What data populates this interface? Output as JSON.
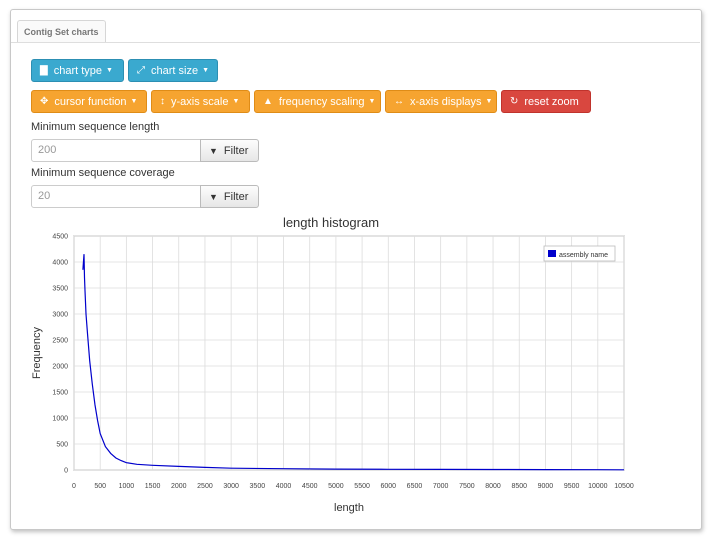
{
  "tab": {
    "label": "Contig Set charts"
  },
  "toolbar1": [
    {
      "label": "chart type",
      "icon": "bar-chart-icon"
    },
    {
      "label": "chart size",
      "icon": "resize-icon"
    }
  ],
  "toolbar2": [
    {
      "label": "cursor function",
      "icon": "move-icon"
    },
    {
      "label": "y-axis scale",
      "icon": "vertical-resize-icon"
    },
    {
      "label": "frequency scaling",
      "icon": "circle-arrow-icon"
    },
    {
      "label": "x-axis displays",
      "icon": "horizontal-resize-icon"
    },
    {
      "label": "reset zoom",
      "icon": "refresh-icon"
    }
  ],
  "filters": {
    "min_length": {
      "label": "Minimum sequence length",
      "value": "200",
      "button": "Filter"
    },
    "min_coverage": {
      "label": "Minimum sequence coverage",
      "value": "20",
      "button": "Filter"
    }
  },
  "chart_data": {
    "type": "line",
    "title": "length histogram",
    "xlabel": "length",
    "ylabel": "Frequency",
    "xlim": [
      0,
      10500
    ],
    "ylim": [
      0,
      4500
    ],
    "xticks": [
      "0",
      "500",
      "1000",
      "1500",
      "2000",
      "2500",
      "3000",
      "3500",
      "4000",
      "4500",
      "5000",
      "5500",
      "6000",
      "6500",
      "7000",
      "7500",
      "8000",
      "8500",
      "9000",
      "9500",
      "10000",
      "10500"
    ],
    "yticks": [
      "0",
      "500",
      "1000",
      "1500",
      "2000",
      "2500",
      "3000",
      "3500",
      "4000",
      "4500"
    ],
    "grid": true,
    "legend": "top-right",
    "series": [
      {
        "name": "assembly name",
        "color": "#0000cc",
        "x": [
          170,
          190,
          200,
          210,
          230,
          260,
          300,
          350,
          400,
          450,
          500,
          600,
          700,
          800,
          900,
          1000,
          1200,
          1500,
          2000,
          2500,
          3000,
          4000,
          5000,
          6000,
          7000,
          8000,
          9000,
          10000,
          10500
        ],
        "y": [
          3850,
          4150,
          3700,
          3450,
          3000,
          2600,
          2100,
          1650,
          1250,
          950,
          700,
          450,
          320,
          230,
          180,
          140,
          110,
          90,
          70,
          50,
          35,
          25,
          18,
          14,
          11,
          9,
          7,
          5,
          4
        ]
      }
    ]
  }
}
